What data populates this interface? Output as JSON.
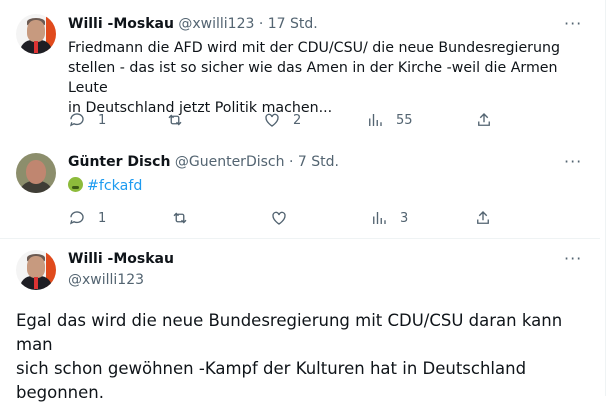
{
  "tweets": [
    {
      "name": "Willi -Moskau",
      "handle": "@xwilli123",
      "time": "· 17 Std.",
      "text_lines": [
        "Friedmann  die AFD wird mit der CDU/CSU/ die neue Bundesregierung",
        "stellen - das ist so sicher wie das Amen in der Kirche -weil die Armen Leute",
        "in Deutschland jetzt Politik machen..."
      ],
      "replies": "1",
      "retweets": "",
      "likes": "2",
      "views": "55"
    },
    {
      "name": "Günter Disch",
      "handle": "@GuenterDisch",
      "time": "· 7 Std.",
      "hashtag": "#fckafd",
      "emoji": "nauseated-face-emoji",
      "replies": "1",
      "retweets": "",
      "likes": "",
      "views": "3"
    }
  ],
  "main_tweet": {
    "name": "Willi -Moskau",
    "handle": "@xwilli123",
    "text_lines": [
      "Egal das wird die neue Bundesregierung mit CDU/CSU  daran kann man",
      "sich schon gewöhnen -Kampf der Kulturen hat in Deutschland",
      "begonnen."
    ]
  },
  "more_label": "···",
  "colors": {
    "accent": "#1d9bf0",
    "muted": "#536471",
    "text": "#0f1419"
  }
}
